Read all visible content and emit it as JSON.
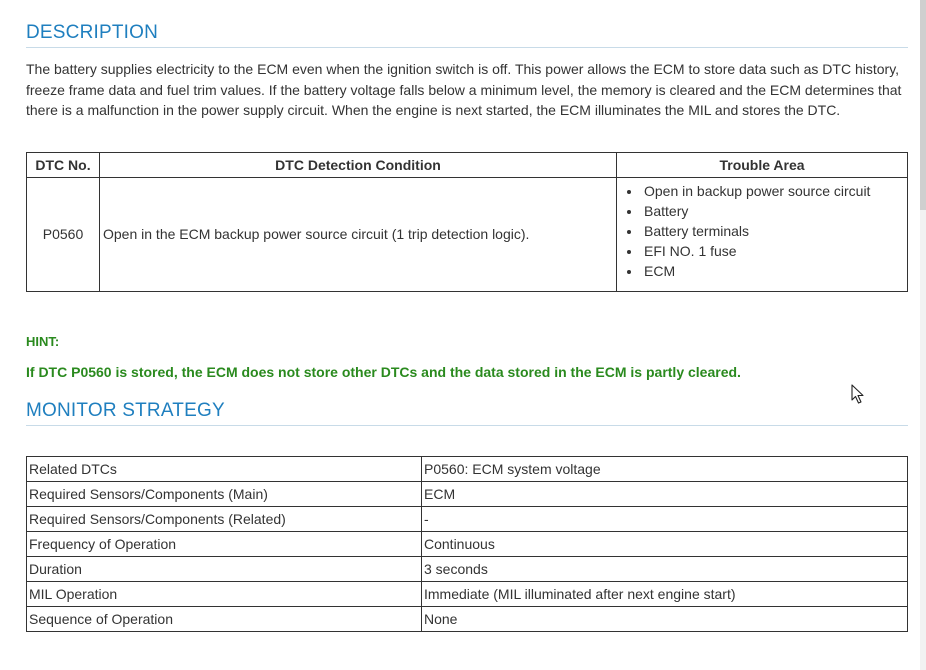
{
  "description": {
    "title": "DESCRIPTION",
    "text": "The battery supplies electricity to the ECM even when the ignition switch is off. This power allows the ECM to store data such as DTC history, freeze frame data and fuel trim values. If the battery voltage falls below a minimum level, the memory is cleared and the ECM determines that there is a malfunction in the power supply circuit. When the engine is next started, the ECM illuminates the MIL and stores the DTC."
  },
  "dtc_table": {
    "headers": [
      "DTC No.",
      "DTC Detection Condition",
      "Trouble Area"
    ],
    "rows": [
      {
        "dtc": "P0560",
        "condition": "Open in the ECM backup power source circuit (1 trip detection logic).",
        "trouble_areas": [
          "Open in backup power source circuit",
          "Battery",
          "Battery terminals",
          "EFI NO. 1 fuse",
          "ECM"
        ]
      }
    ]
  },
  "hint": {
    "label": "HINT:",
    "text": "If DTC P0560 is stored, the ECM does not store other DTCs and the data stored in the ECM is partly cleared."
  },
  "monitor": {
    "title": "MONITOR STRATEGY",
    "rows": [
      {
        "label": "Related DTCs",
        "value": "P0560: ECM system voltage"
      },
      {
        "label": "Required Sensors/Components (Main)",
        "value": "ECM"
      },
      {
        "label": "Required Sensors/Components (Related)",
        "value": "-"
      },
      {
        "label": "Frequency of Operation",
        "value": "Continuous"
      },
      {
        "label": "Duration",
        "value": "3 seconds"
      },
      {
        "label": "MIL Operation",
        "value": "Immediate (MIL illuminated after next engine start)"
      },
      {
        "label": "Sequence of Operation",
        "value": "None"
      }
    ]
  }
}
